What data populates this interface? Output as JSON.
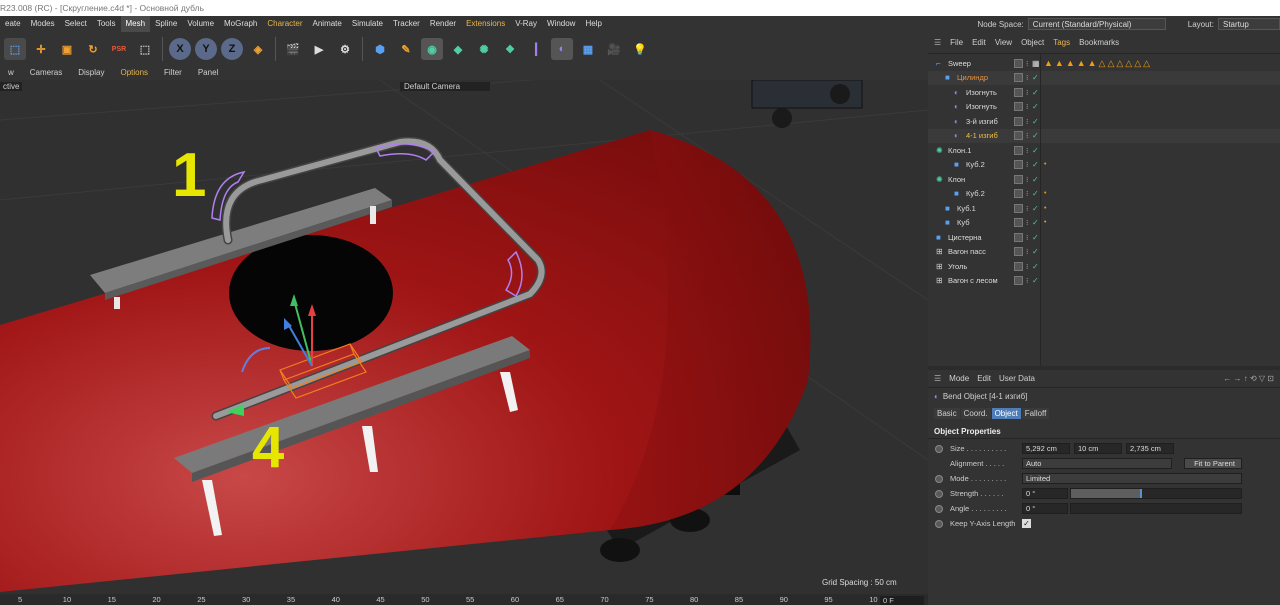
{
  "titlebar": {
    "text": "R23.008 (RC) - [Скругление.c4d *] - Основной дубль"
  },
  "menubar": {
    "items": [
      "eate",
      "Modes",
      "Select",
      "Tools",
      "Mesh",
      "Spline",
      "Volume",
      "MoGraph",
      "Character",
      "Animate",
      "Simulate",
      "Tracker",
      "Render",
      "Extensions",
      "V-Ray",
      "Window",
      "Help"
    ],
    "active": "Mesh"
  },
  "nodespace": {
    "label": "Node Space:",
    "value": "Current (Standard/Physical)",
    "layout_label": "Layout:",
    "layout_value": "Startup"
  },
  "viewport": {
    "menu": [
      "w",
      "Cameras",
      "Display",
      "Options",
      "Filter",
      "Panel"
    ],
    "mode_label": "ctive",
    "camera_label": "Default Camera",
    "grid_spacing": "Grid Spacing : 50 cm",
    "annotation_1": "1",
    "annotation_4": "4"
  },
  "ruler": {
    "ticks": [
      "5",
      "10",
      "15",
      "20",
      "25",
      "30",
      "35",
      "40",
      "45",
      "50",
      "55",
      "60",
      "65",
      "70",
      "75",
      "80",
      "85",
      "90",
      "95",
      "10"
    ],
    "frame": "0 F"
  },
  "objects": {
    "menu": [
      "File",
      "Edit",
      "View",
      "Object",
      "Tags",
      "Bookmarks"
    ],
    "rows": [
      {
        "name": "Sweep",
        "indent": 0,
        "color": "#dddddd",
        "tags": "▲▲▲▲▲△△△△△△"
      },
      {
        "name": "Цилиндр",
        "indent": 1,
        "color": "#e8903c",
        "tags": ""
      },
      {
        "name": "Изогнуть",
        "indent": 2,
        "color": "#dddddd",
        "tags": ""
      },
      {
        "name": "Изогнуть",
        "indent": 2,
        "color": "#dddddd",
        "tags": ""
      },
      {
        "name": "3-й изгиб",
        "indent": 2,
        "color": "#dddddd",
        "tags": ""
      },
      {
        "name": "4-1 изгиб",
        "indent": 2,
        "color": "#f0c040",
        "tags": ""
      },
      {
        "name": "Клон.1",
        "indent": 0,
        "color": "#dddddd",
        "tags": ""
      },
      {
        "name": "Куб.2",
        "indent": 2,
        "color": "#dddddd",
        "tags": "•"
      },
      {
        "name": "Клон",
        "indent": 0,
        "color": "#dddddd",
        "tags": ""
      },
      {
        "name": "Куб.2",
        "indent": 2,
        "color": "#dddddd",
        "tags": "•"
      },
      {
        "name": "Куб.1",
        "indent": 1,
        "color": "#dddddd",
        "tags": "•"
      },
      {
        "name": "Куб",
        "indent": 1,
        "color": "#dddddd",
        "tags": "•"
      },
      {
        "name": "Цистерна",
        "indent": 0,
        "color": "#dddddd",
        "tags": ""
      },
      {
        "name": "Вагон пасс",
        "indent": 0,
        "color": "#dddddd",
        "tags": ""
      },
      {
        "name": "Уголь",
        "indent": 0,
        "color": "#dddddd",
        "tags": ""
      },
      {
        "name": "Вагон с лесом",
        "indent": 0,
        "color": "#dddddd",
        "tags": ""
      }
    ]
  },
  "attributes": {
    "menu": [
      "Mode",
      "Edit",
      "User Data"
    ],
    "object_title": "Bend Object [4-1 изгиб]",
    "tabs": [
      "Basic",
      "Coord.",
      "Object",
      "Falloff"
    ],
    "active_tab": "Object",
    "section": "Object Properties",
    "size_label": "Size . . . . . . . . . .",
    "size": [
      "5,292 cm",
      "10 cm",
      "2,735 cm"
    ],
    "alignment_label": "Alignment . . . . .",
    "alignment": "Auto",
    "fit_button": "Fit to Parent",
    "mode_label": "Mode . . . . . . . . .",
    "mode": "Limited",
    "strength_label": "Strength . . . . . .",
    "strength": "0 °",
    "strength_level": 0.42,
    "angle_label": "Angle . . . . . . . . .",
    "angle": "0 °",
    "keep_y_label": "Keep Y-Axis Length"
  },
  "colors": {
    "accent": "#4e7db8",
    "tank": "#b01818",
    "annotation": "#e6e600"
  }
}
